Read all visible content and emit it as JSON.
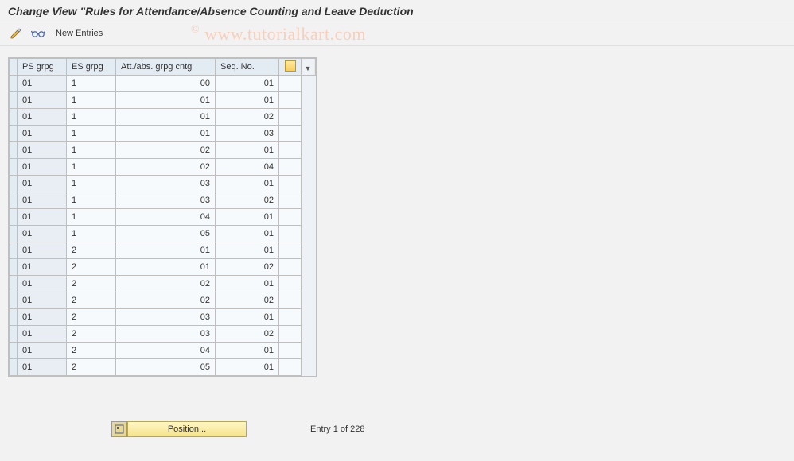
{
  "header": {
    "title": "Change View \"Rules for Attendance/Absence Counting and Leave Deduction"
  },
  "toolbar": {
    "new_entries_label": "New Entries"
  },
  "watermark": {
    "copy": "©",
    "text": "www.tutorialkart.com"
  },
  "table": {
    "headers": {
      "ps": "PS grpg",
      "es": "ES grpg",
      "att": "Att./abs. grpg cntg",
      "seq": "Seq. No."
    },
    "rows": [
      {
        "ps": "01",
        "es": "1",
        "att": "00",
        "seq": "01"
      },
      {
        "ps": "01",
        "es": "1",
        "att": "01",
        "seq": "01"
      },
      {
        "ps": "01",
        "es": "1",
        "att": "01",
        "seq": "02"
      },
      {
        "ps": "01",
        "es": "1",
        "att": "01",
        "seq": "03"
      },
      {
        "ps": "01",
        "es": "1",
        "att": "02",
        "seq": "01"
      },
      {
        "ps": "01",
        "es": "1",
        "att": "02",
        "seq": "04"
      },
      {
        "ps": "01",
        "es": "1",
        "att": "03",
        "seq": "01"
      },
      {
        "ps": "01",
        "es": "1",
        "att": "03",
        "seq": "02"
      },
      {
        "ps": "01",
        "es": "1",
        "att": "04",
        "seq": "01"
      },
      {
        "ps": "01",
        "es": "1",
        "att": "05",
        "seq": "01"
      },
      {
        "ps": "01",
        "es": "2",
        "att": "01",
        "seq": "01"
      },
      {
        "ps": "01",
        "es": "2",
        "att": "01",
        "seq": "02"
      },
      {
        "ps": "01",
        "es": "2",
        "att": "02",
        "seq": "01"
      },
      {
        "ps": "01",
        "es": "2",
        "att": "02",
        "seq": "02"
      },
      {
        "ps": "01",
        "es": "2",
        "att": "03",
        "seq": "01"
      },
      {
        "ps": "01",
        "es": "2",
        "att": "03",
        "seq": "02"
      },
      {
        "ps": "01",
        "es": "2",
        "att": "04",
        "seq": "01"
      },
      {
        "ps": "01",
        "es": "2",
        "att": "05",
        "seq": "01"
      }
    ]
  },
  "footer": {
    "position_label": "Position...",
    "entry_text": "Entry 1 of 228"
  }
}
